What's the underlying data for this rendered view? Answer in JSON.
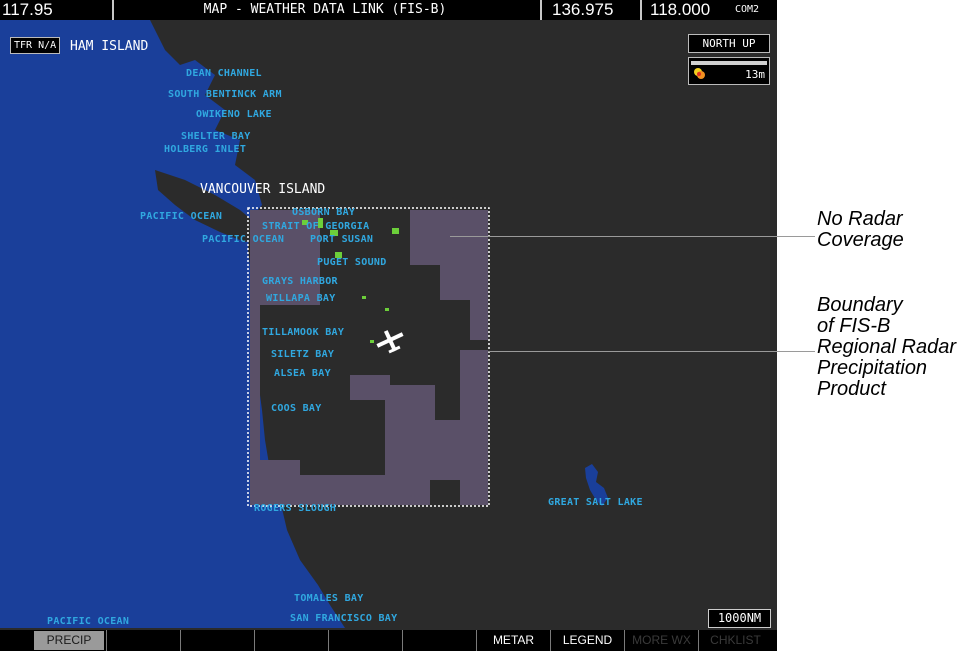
{
  "topbar": {
    "nav_freq": "117.95",
    "title": "MAP - WEATHER DATA LINK (FIS-B)",
    "com1_freq": "136.975",
    "com2_freq": "118.000",
    "com2_label": "COM2"
  },
  "map": {
    "tfr_label": "TFR N/A",
    "orientation": "NORTH UP",
    "legend_time": "13m",
    "range": "1000NM",
    "labels": {
      "graham_island": "HAM ISLAND",
      "dean_channel": "DEAN CHANNEL",
      "south_bentinck": "SOUTH BENTINCK ARM",
      "owikeno": "OWIKENO LAKE",
      "shelter_bay": "SHELTER BAY",
      "holberg": "HOLBERG INLET",
      "vancouver_island": "VANCOUVER ISLAND",
      "pacific_ocean_1": "PACIFIC OCEAN",
      "osborn_bay": "OSBORN BAY",
      "strait_georgia": "STRAIT OF GEORGIA",
      "pacific_ocean_2": "PACIFIC OCEAN",
      "port_susan": "PORT SUSAN",
      "puget_sound": "PUGET SOUND",
      "grays_harbor": "GRAYS HARBOR",
      "willapa": "WILLAPA BAY",
      "tillamook": "TILLAMOOK BAY",
      "siletz": "SILETZ BAY",
      "alsea": "ALSEA BAY",
      "coos": "COOS BAY",
      "rogers_slough": "ROGERS SLOUGH",
      "great_salt_lake": "GREAT SALT LAKE",
      "tomales": "TOMALES BAY",
      "san_francisco": "SAN FRANCISCO BAY",
      "pacific_ocean_3": "PACIFIC OCEAN"
    }
  },
  "softkeys": [
    "PRECIP",
    "",
    "",
    "",
    "",
    "",
    "METAR",
    "LEGEND",
    "MORE WX",
    "CHKLIST"
  ],
  "annotations": {
    "no_radar": [
      "No Radar",
      "Coverage"
    ],
    "boundary": [
      "Boundary",
      "of FIS-B",
      "Regional Radar",
      "Precipitation",
      "Product"
    ]
  },
  "colors": {
    "ocean": "#1a3f9a",
    "land": "#2b2b2b",
    "no_coverage": "#5a5068",
    "label": "#30a8e0",
    "precip": "#6ccf3a"
  }
}
